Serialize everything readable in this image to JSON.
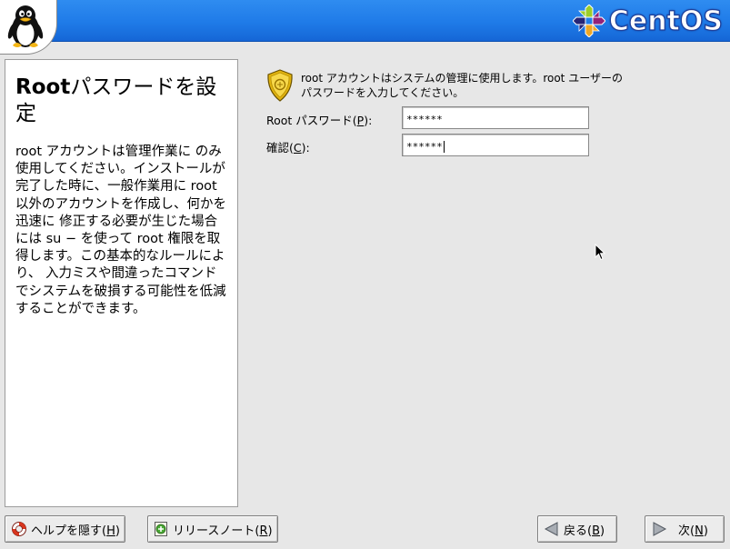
{
  "header": {
    "brand": "CentOS",
    "mascot_icon": "tux-penguin-icon",
    "brand_icon": "centos-logo-icon",
    "colors": {
      "banner": "#1f7be8"
    }
  },
  "help": {
    "title_bold": "Root",
    "title_rest": "パスワードを設定",
    "body": "root アカウントは管理作業に のみ 使用してください。インストールが完了した時に、一般作業用に root 以外のアカウントを作成し、何かを迅速に 修正する必要が生じた場合には su − を使って root 権限を取得します。この基本的なルールにより、 入力ミスや間違ったコマンドでシステムを破損する可能性を低減することができます。"
  },
  "form": {
    "intro": "root アカウントはシステムの管理に使用します。root ユーザーのパスワードを入力してください。",
    "root_label_pre": "Root パスワード(",
    "root_label_key": "P",
    "root_label_post": "):",
    "root_value": "******",
    "confirm_label_pre": "確認(",
    "confirm_label_key": "C",
    "confirm_label_post": "):",
    "confirm_value": "******"
  },
  "buttons": {
    "hide_help_pre": "ヘルプを隠す(",
    "hide_help_key": "H",
    "hide_help_post": ")",
    "release_notes_pre": "リリースノート(",
    "release_notes_key": "R",
    "release_notes_post": ")",
    "back_pre": "戻る(",
    "back_key": "B",
    "back_post": ")",
    "next_pre": "次(",
    "next_key": "N",
    "next_post": ")"
  }
}
